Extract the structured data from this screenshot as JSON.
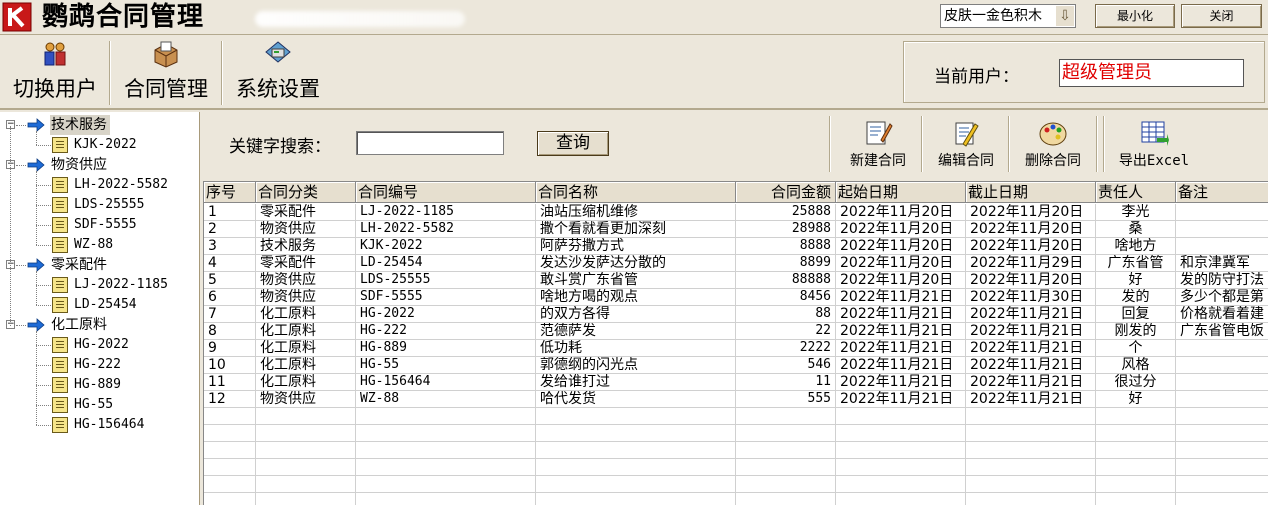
{
  "app": {
    "title": "鹦鹉合同管理",
    "skin_select": "皮肤一金色积木",
    "minimize_label": "最小化",
    "close_label": "关闭"
  },
  "toolbar": {
    "switch_user": "切换用户",
    "contracts": "合同管理",
    "settings": "系统设置",
    "current_user_label": "当前用户：",
    "current_user_value": "超级管理员"
  },
  "tree": {
    "groups": [
      {
        "label": "技术服务",
        "items": [
          "KJK-2022"
        ]
      },
      {
        "label": "物资供应",
        "items": [
          "LH-2022-5582",
          "LDS-25555",
          "SDF-5555",
          "WZ-88"
        ]
      },
      {
        "label": "零采配件",
        "items": [
          "LJ-2022-1185",
          "LD-25454"
        ]
      },
      {
        "label": "化工原料",
        "items": [
          "HG-2022",
          "HG-222",
          "HG-889",
          "HG-55",
          "HG-156464"
        ]
      }
    ]
  },
  "search": {
    "label": "关键字搜索：",
    "value": "",
    "button": "查询"
  },
  "actions": {
    "new": "新建合同",
    "edit": "编辑合同",
    "delete": "删除合同",
    "export": "导出Excel"
  },
  "table": {
    "columns": [
      "序号",
      "合同分类",
      "合同编号",
      "合同名称",
      "合同金额",
      "起始日期",
      "截止日期",
      "责任人",
      "备注"
    ],
    "rows": [
      [
        "1",
        "零采配件",
        "LJ-2022-1185",
        "油站压缩机维修",
        "25888",
        "2022年11月20日",
        "2022年11月20日",
        "李光",
        ""
      ],
      [
        "2",
        "物资供应",
        "LH-2022-5582",
        "撒个看就看更加深刻",
        "28988",
        "2022年11月20日",
        "2022年11月20日",
        "桑",
        ""
      ],
      [
        "3",
        "技术服务",
        "KJK-2022",
        "阿萨芬撒方式",
        "8888",
        "2022年11月20日",
        "2022年11月20日",
        "啥地方",
        ""
      ],
      [
        "4",
        "零采配件",
        "LD-25454",
        "发达沙发萨达分散的",
        "8899",
        "2022年11月20日",
        "2022年11月29日",
        "广东省管",
        "和京津冀军"
      ],
      [
        "5",
        "物资供应",
        "LDS-25555",
        "敢斗赏广东省管",
        "88888",
        "2022年11月20日",
        "2022年11月20日",
        "好",
        "发的防守打法"
      ],
      [
        "6",
        "物资供应",
        "SDF-5555",
        "啥地方喝的观点",
        "8456",
        "2022年11月21日",
        "2022年11月30日",
        "发的",
        "多少个都是第"
      ],
      [
        "7",
        "化工原料",
        "HG-2022",
        "的双方各得",
        "88",
        "2022年11月21日",
        "2022年11月21日",
        "回复",
        "价格就看着建"
      ],
      [
        "8",
        "化工原料",
        "HG-222",
        "范德萨发",
        "22",
        "2022年11月21日",
        "2022年11月21日",
        "刚发的",
        "广东省管电饭"
      ],
      [
        "9",
        "化工原料",
        "HG-889",
        "低功耗",
        "2222",
        "2022年11月21日",
        "2022年11月21日",
        "个",
        ""
      ],
      [
        "10",
        "化工原料",
        "HG-55",
        "郭德纲的闪光点",
        "546",
        "2022年11月21日",
        "2022年11月21日",
        "风格",
        ""
      ],
      [
        "11",
        "化工原料",
        "HG-156464",
        "发给谁打过",
        "11",
        "2022年11月21日",
        "2022年11月21日",
        "很过分",
        ""
      ],
      [
        "12",
        "物资供应",
        "WZ-88",
        "哈代发货",
        "555",
        "2022年11月21日",
        "2022年11月21日",
        "好",
        ""
      ]
    ]
  },
  "colors": {
    "background": "#ece7db",
    "current_user_text": "#e00000",
    "tree_arrow": "#1e6bd6"
  }
}
